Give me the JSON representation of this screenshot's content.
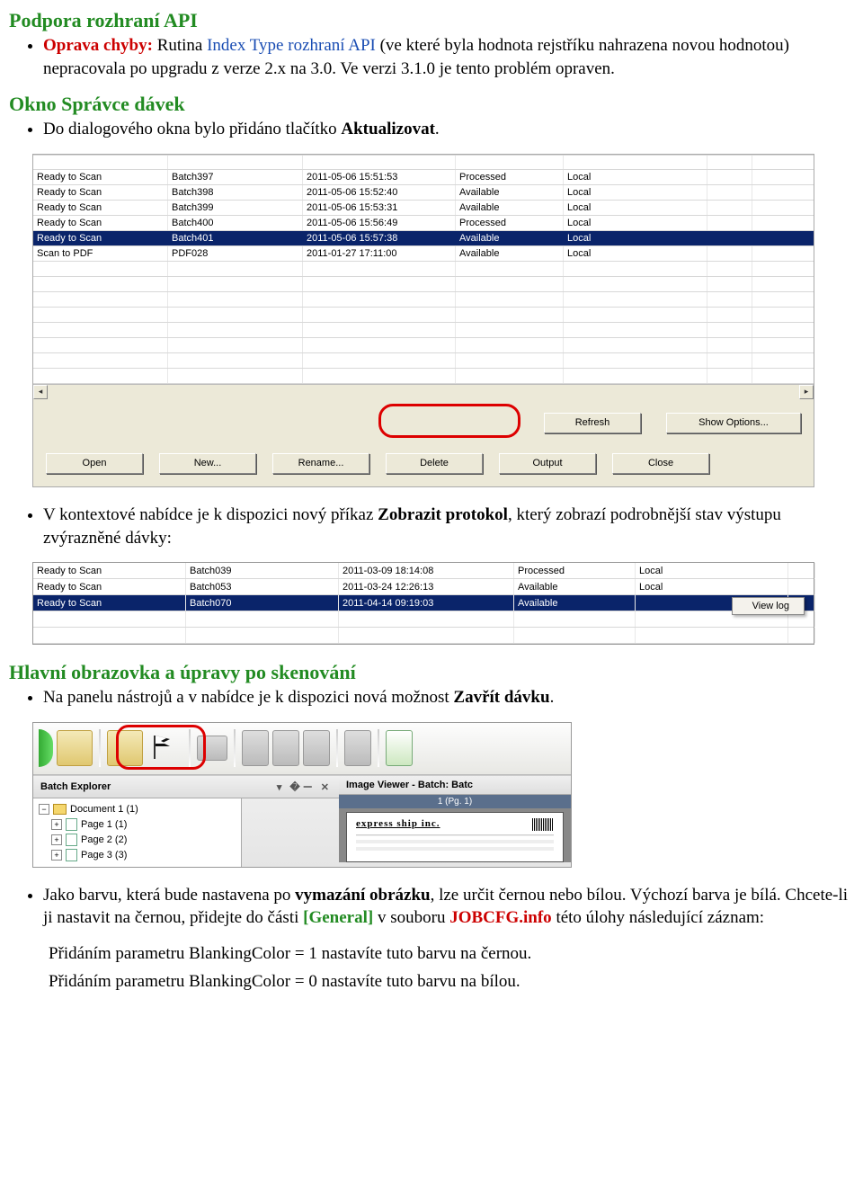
{
  "section1": {
    "title": "Podpora rozhraní API",
    "bullet1_prefix": "Oprava chyby:",
    "bullet1_mid1": " Rutina ",
    "bullet1_blue": "Index Type rozhraní API",
    "bullet1_rest": " (ve které byla hodnota rejstříku nahrazena novou hodnotou) nepracovala po upgradu z verze 2.x na 3.0.  Ve verzi 3.1.0 je tento problém opraven."
  },
  "section2": {
    "title": "Okno Správce dávek",
    "bullet1_a": "Do dialogového okna bylo přidáno tlačítko ",
    "bullet1_b": "Aktualizovat",
    "bullet1_c": "."
  },
  "grid1": {
    "rows": [
      {
        "c1": "Ready to Scan",
        "c2": "Batch397",
        "c3": "2011-05-06 15:51:53",
        "c4": "Processed",
        "c5": "Local"
      },
      {
        "c1": "Ready to Scan",
        "c2": "Batch398",
        "c3": "2011-05-06 15:52:40",
        "c4": "Available",
        "c5": "Local"
      },
      {
        "c1": "Ready to Scan",
        "c2": "Batch399",
        "c3": "2011-05-06 15:53:31",
        "c4": "Available",
        "c5": "Local"
      },
      {
        "c1": "Ready to Scan",
        "c2": "Batch400",
        "c3": "2011-05-06 15:56:49",
        "c4": "Processed",
        "c5": "Local"
      },
      {
        "c1": "Ready to Scan",
        "c2": "Batch401",
        "c3": "2011-05-06 15:57:38",
        "c4": "Available",
        "c5": "Local",
        "selected": true
      },
      {
        "c1": "Scan to PDF",
        "c2": "PDF028",
        "c3": "2011-01-27 17:11:00",
        "c4": "Available",
        "c5": "Local"
      }
    ],
    "refresh": "Refresh",
    "options": "Show Options...",
    "open": "Open",
    "new": "New...",
    "rename": "Rename...",
    "delete": "Delete",
    "output": "Output",
    "close": "Close"
  },
  "section3": {
    "bullet_a": "V kontextové nabídce je k dispozici nový příkaz ",
    "bullet_b": "Zobrazit protokol",
    "bullet_c": ", který zobrazí podrobnější stav výstupu zvýrazněné dávky:"
  },
  "grid2": {
    "rows": [
      {
        "c1": "Ready to Scan",
        "c2": "Batch039",
        "c3": "2011-03-09 18:14:08",
        "c4": "Processed",
        "c5": "Local"
      },
      {
        "c1": "Ready to Scan",
        "c2": "Batch053",
        "c3": "2011-03-24 12:26:13",
        "c4": "Available",
        "c5": "Local"
      },
      {
        "c1": "Ready to Scan",
        "c2": "Batch070",
        "c3": "2011-04-14 09:19:03",
        "c4": "Available",
        "c5": "",
        "selected": true
      }
    ],
    "menu": "View log"
  },
  "section4": {
    "title": "Hlavní obrazovka a úpravy po skenování",
    "bullet1_a": "Na panelu nástrojů a v nabídce je k dispozici nová možnost ",
    "bullet1_b": "Zavřít dávku",
    "bullet1_c": "."
  },
  "toolbar": {
    "explorer": "Batch Explorer",
    "viewer": "Image Viewer - Batch: Batc",
    "pinclose": "▾ �ー ✕",
    "tree": {
      "doc": "Document 1 (1)",
      "p1": "Page 1 (1)",
      "p2": "Page 2 (2)",
      "p3": "Page 3 (3)"
    },
    "pgtitle": "1 (Pg. 1)",
    "express": "express ship inc."
  },
  "section5": {
    "bullet_a": "Jako barvu, která bude nastavena po ",
    "bullet_b": "vymazání obrázku",
    "bullet_c": ", lze určit černou nebo bílou. Výchozí barva je bílá. Chcete-li ji nastavit na černou, přidejte do části ",
    "bullet_d": "[General]",
    "bullet_e": " v souboru ",
    "bullet_f": "JOBCFG.info",
    "bullet_g": " této úlohy následující záznam:",
    "line1": "Přidáním parametru BlankingColor = 1 nastavíte tuto barvu na černou.",
    "line2": "Přidáním parametru BlankingColor = 0 nastavíte tuto barvu na bílou."
  }
}
